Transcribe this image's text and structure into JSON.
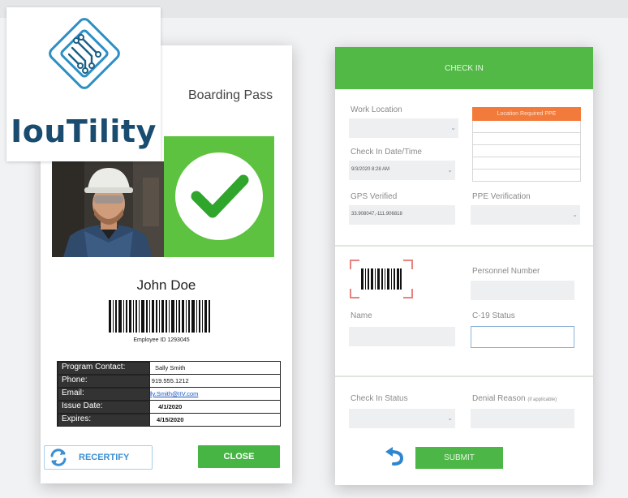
{
  "brand": {
    "name": "IouTility"
  },
  "boarding_pass": {
    "title": "Boarding Pass",
    "name": "John Doe",
    "employee_id": "Employee ID 1293045",
    "details": [
      {
        "label": "Program Contact:",
        "value": "Sally Smith"
      },
      {
        "label": "Phone:",
        "value": "919.555.1212"
      },
      {
        "label": "Email:",
        "value": "Sally.Smith@IIV.com"
      },
      {
        "label": "Issue Date:",
        "value": "4/1/2020"
      },
      {
        "label": "Expires:",
        "value": "4/15/2020"
      }
    ],
    "recertify_label": "RECERTIFY",
    "close_label": "CLOSE",
    "status_color": "#5cc23f"
  },
  "check_in": {
    "header": "CHECK IN",
    "work_location_label": "Work Location",
    "location_ppe_header": "Location Required PPE",
    "datetime_label": "Check In Date/Time",
    "datetime_value": "9/3/2020 8:28 AM",
    "gps_label": "GPS Verified",
    "gps_value": "33.908047,-111.906818",
    "ppe_verification_label": "PPE Verification",
    "personnel_number_label": "Personnel Number",
    "name_label": "Name",
    "c19_label": "C-19 Status",
    "checkin_status_label": "Check In Status",
    "denial_reason_label": "Denial Reason",
    "denial_reason_note": "(if applicable)",
    "submit_label": "SUBMIT",
    "accent_color": "#52b947",
    "ppe_color": "#f27a3a"
  }
}
